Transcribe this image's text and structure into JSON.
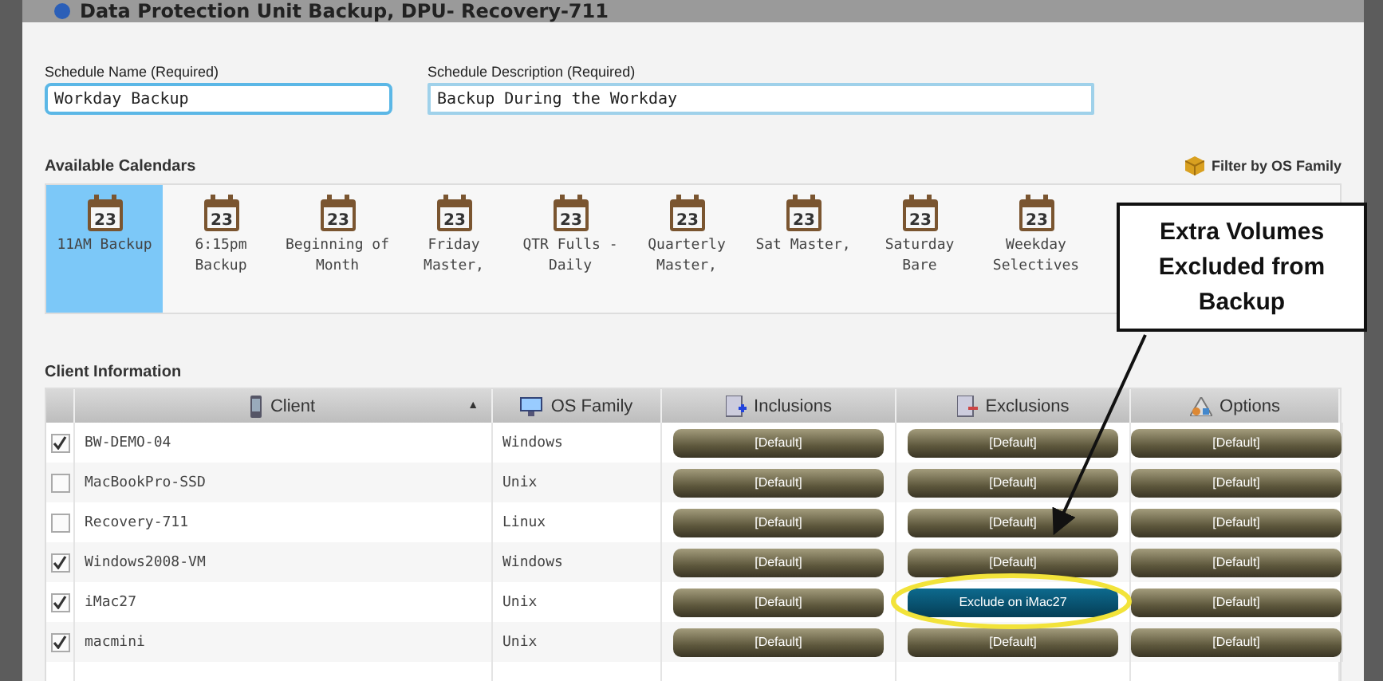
{
  "window": {
    "title": "Data Protection Unit Backup, DPU- Recovery-711"
  },
  "schedule_name": {
    "label": "Schedule Name (Required)",
    "value": "Workday Backup"
  },
  "schedule_description": {
    "label": "Schedule Description (Required)",
    "value": "Backup During the Workday"
  },
  "calendars": {
    "title": "Available Calendars",
    "filter_label": "Filter by OS Family",
    "items": [
      {
        "day": "23",
        "label": "11AM Backup",
        "selected": true
      },
      {
        "day": "23",
        "label": "6:15pm Backup",
        "selected": false
      },
      {
        "day": "23",
        "label": "Beginning of Month",
        "selected": false
      },
      {
        "day": "23",
        "label": "Friday Master,",
        "selected": false
      },
      {
        "day": "23",
        "label": "QTR Fulls - Daily",
        "selected": false
      },
      {
        "day": "23",
        "label": "Quarterly Master,",
        "selected": false
      },
      {
        "day": "23",
        "label": "Sat Master,",
        "selected": false
      },
      {
        "day": "23",
        "label": "Saturday Bare",
        "selected": false
      },
      {
        "day": "23",
        "label": "Weekday Selectives",
        "selected": false
      }
    ]
  },
  "client_table": {
    "title": "Client Information",
    "columns": [
      {
        "label": "Client",
        "sort": "▲"
      },
      {
        "label": "OS Family"
      },
      {
        "label": "Inclusions"
      },
      {
        "label": "Exclusions"
      },
      {
        "label": "Options"
      }
    ],
    "rows": [
      {
        "checked": true,
        "client": "BW-DEMO-04",
        "os": "Windows",
        "inclusions": "[Default]",
        "exclusions": {
          "kind": "default",
          "label": "[Default]"
        },
        "options": "[Default]"
      },
      {
        "checked": false,
        "client": "MacBookPro-SSD",
        "os": "Unix",
        "inclusions": "[Default]",
        "exclusions": {
          "kind": "default",
          "label": "[Default]"
        },
        "options": "[Default]"
      },
      {
        "checked": false,
        "client": "Recovery-711",
        "os": "Linux",
        "inclusions": "[Default]",
        "exclusions": {
          "kind": "default",
          "label": "[Default]"
        },
        "options": "[Default]"
      },
      {
        "checked": true,
        "client": "Windows2008-VM",
        "os": "Windows",
        "inclusions": "[Default]",
        "exclusions": {
          "kind": "default",
          "label": "[Default]"
        },
        "options": "[Default]"
      },
      {
        "checked": true,
        "client": "iMac27",
        "os": "Unix",
        "inclusions": "[Default]",
        "exclusions": {
          "kind": "custom",
          "label": "Exclude on iMac27"
        },
        "options": "[Default]"
      },
      {
        "checked": true,
        "client": "macmini",
        "os": "Unix",
        "inclusions": "[Default]",
        "exclusions": {
          "kind": "default",
          "label": "[Default]"
        },
        "options": "[Default]"
      }
    ]
  },
  "annotation": {
    "text": "Extra Volumes Excluded from Backup"
  }
}
